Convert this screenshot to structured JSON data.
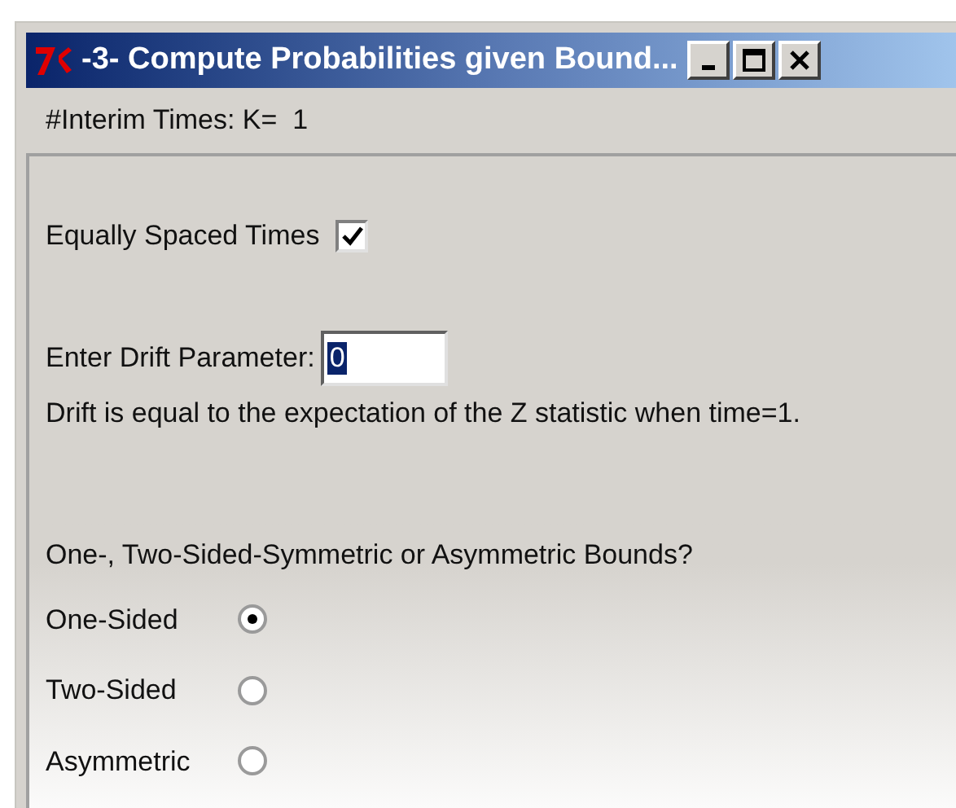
{
  "window": {
    "title": "-3- Compute Probabilities given Bound..."
  },
  "header": {
    "label": "#Interim Times: K=  1"
  },
  "equally_spaced": {
    "label": "Equally Spaced Times",
    "checked": true
  },
  "drift": {
    "label": "Enter Drift Parameter:",
    "value": "0",
    "note": "Drift is equal to the expectation of the Z statistic when time=1."
  },
  "bounds": {
    "question": "One-, Two-Sided-Symmetric or Asymmetric Bounds?",
    "options": [
      {
        "label": "One-Sided",
        "selected": true
      },
      {
        "label": "Two-Sided",
        "selected": false
      },
      {
        "label": "Asymmetric",
        "selected": false
      }
    ]
  }
}
